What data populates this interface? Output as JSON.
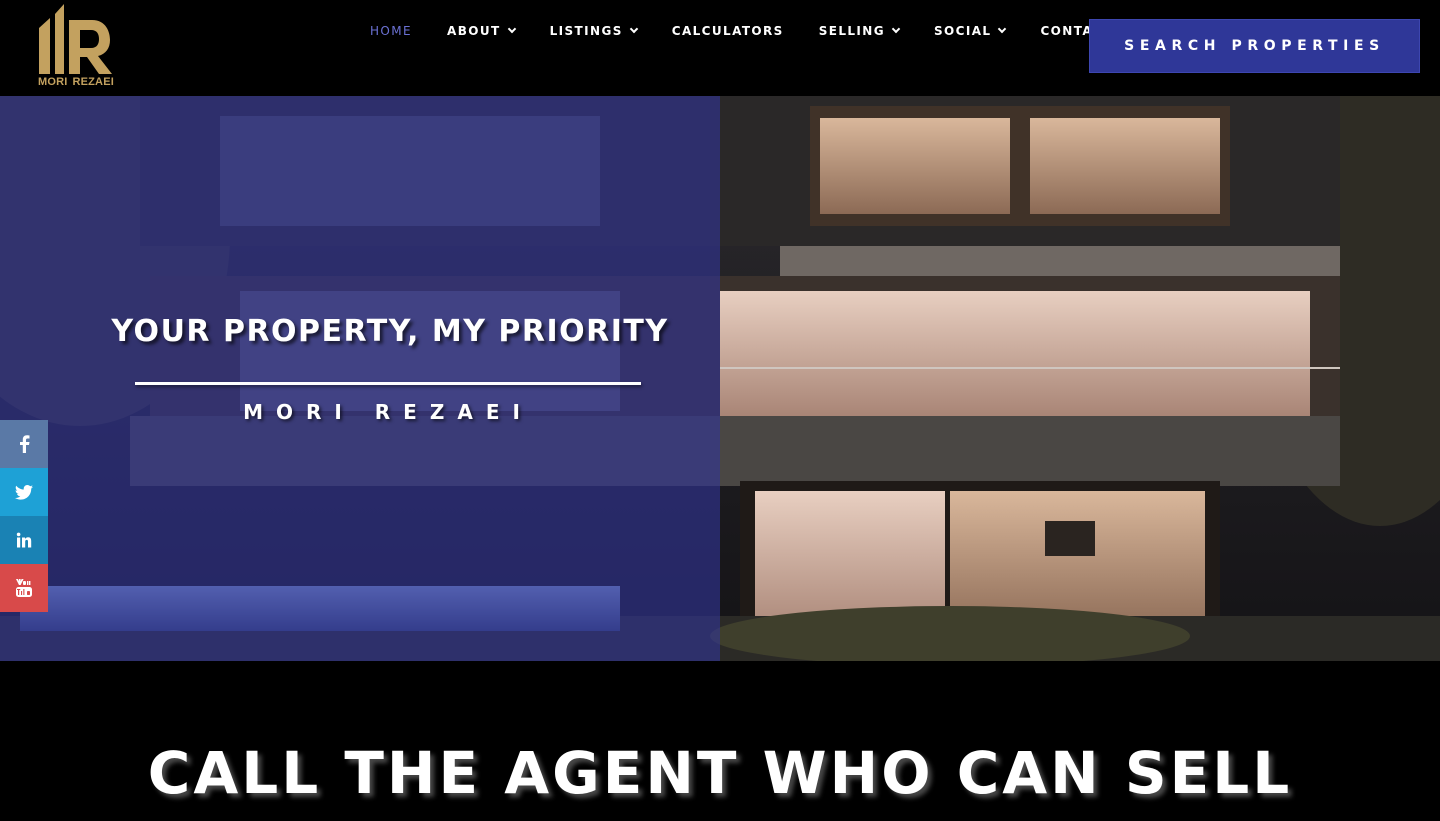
{
  "brand": {
    "logo_line1": "MORI",
    "logo_line2": "REZAEI"
  },
  "nav": {
    "home": "HOME",
    "about": "ABOUT",
    "listings": "LISTINGS",
    "calculators": "CALCULATORS",
    "selling": "SELLING",
    "social": "SOCIAL",
    "contact": "CONTACT"
  },
  "search_button": "SEARCH PROPERTIES",
  "hero": {
    "title": "YOUR PROPERTY, MY PRIORITY",
    "subtitle": "MORI REZAEI"
  },
  "social": [
    {
      "icon": "facebook-icon",
      "color": "#5a79a6"
    },
    {
      "icon": "twitter-icon",
      "color": "#1ea1d6"
    },
    {
      "icon": "linkedin-icon",
      "color": "#1a82b4"
    },
    {
      "icon": "youtube-icon",
      "color": "#d84a4a"
    }
  ],
  "section": {
    "title": "CALL THE AGENT WHO CAN SELL"
  },
  "colors": {
    "accent": "#2f3798",
    "active_nav": "#6b71d4",
    "gold": "#c3a15f"
  }
}
